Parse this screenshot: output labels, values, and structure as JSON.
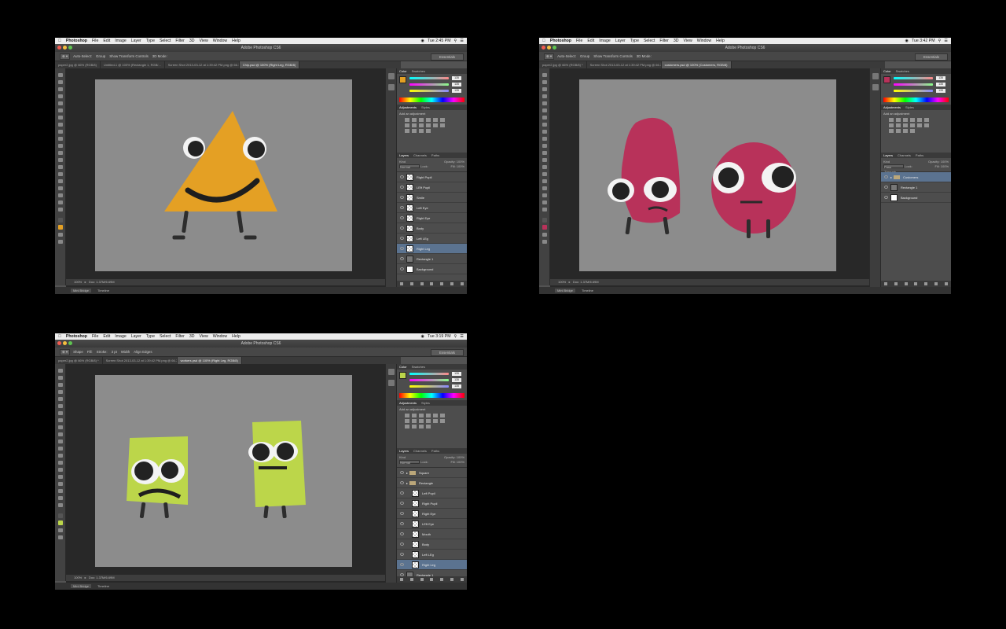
{
  "windows": [
    {
      "menubar": {
        "apple": "",
        "app": "Photoshop",
        "items": [
          "File",
          "Edit",
          "Image",
          "Layer",
          "Type",
          "Select",
          "Filter",
          "3D",
          "View",
          "Window",
          "Help"
        ],
        "clock": "Tue 2:45 PM"
      },
      "title": "Adobe Photoshop CS6",
      "options": [
        "Auto-Select:",
        "Group",
        "Show Transform Controls",
        "3D Mode:"
      ],
      "workspace": "Essentials",
      "tabs": [
        "paper2.jpg @ 66% (RGB/8)",
        "Untitled-1 @ 100% (Rectangle 1, RGB/...",
        "Screen Shot 2013-03-12 at 1:39:42 PM.png @ 66.7% (...",
        "Chip.psd @ 100% (Right Leg, RGB/8)"
      ],
      "status": {
        "zoom": "100%",
        "doc": "Doc: 1.37M/6.69M"
      },
      "bottom": [
        "Mini Bridge",
        "Timeline"
      ],
      "panel": {
        "color_tab": "Color",
        "swatches_tab": "Swatches",
        "rgb": [
          "135",
          "135",
          "135"
        ],
        "adjust_tab": "Adjustments",
        "styles_tab": "Styles",
        "adjust_label": "Add an adjustment",
        "layer_tabs": [
          "Layers",
          "Channels",
          "Paths"
        ],
        "kind": "Kind",
        "mode": "Normal",
        "opacity": "Opacity: 100%",
        "fill": "Fill: 100%",
        "lock": "Lock:"
      },
      "layers": [
        {
          "name": "Right Pupil",
          "type": "px"
        },
        {
          "name": "LEft Pupil",
          "type": "px"
        },
        {
          "name": "Smile",
          "type": "px"
        },
        {
          "name": "Left Eye",
          "type": "px"
        },
        {
          "name": "Right Eye",
          "type": "px"
        },
        {
          "name": "Body",
          "type": "px"
        },
        {
          "name": "Left LEg",
          "type": "px"
        },
        {
          "name": "Right Leg",
          "type": "px",
          "selected": true
        },
        {
          "name": "Rectangle 1",
          "type": "fill"
        },
        {
          "name": "Background",
          "type": "white"
        }
      ]
    },
    {
      "menubar": {
        "apple": "",
        "app": "Photoshop",
        "items": [
          "File",
          "Edit",
          "Image",
          "Layer",
          "Type",
          "Select",
          "Filter",
          "3D",
          "View",
          "Window",
          "Help"
        ],
        "clock": "Tue 3:42 PM"
      },
      "title": "Adobe Photoshop CS6",
      "options": [
        "Auto-Select:",
        "Group",
        "Show Transform Controls",
        "3D Mode:"
      ],
      "workspace": "Essentials",
      "tabs": [
        "paper2.jpg @ 66% (RGB/8) *",
        "Screen Shot 2013-03-12 at 1:39:42 PM.png @ 66.7% (RGB/8*) *",
        "customers.psd @ 100% (Customers, RGB/8)"
      ],
      "status": {
        "zoom": "100%",
        "doc": "Doc: 1.37M/6.69M"
      },
      "bottom": [
        "Mini Bridge",
        "Timeline"
      ],
      "panel": {
        "color_tab": "Color",
        "swatches_tab": "Swatches",
        "rgb": [
          "135",
          "135",
          "135"
        ],
        "adjust_tab": "Adjustments",
        "styles_tab": "Styles",
        "adjust_label": "Add an adjustment",
        "layer_tabs": [
          "Layers",
          "Channels",
          "Paths"
        ],
        "kind": "Kind",
        "mode": "Pass Through",
        "opacity": "Opacity: 100%",
        "fill": "Fill: 100%",
        "lock": "Lock:"
      },
      "layers": [
        {
          "name": "Customers",
          "type": "group",
          "selected": true
        },
        {
          "name": "Rectangle 1",
          "type": "fill"
        },
        {
          "name": "Background",
          "type": "white"
        }
      ]
    },
    {
      "menubar": {
        "apple": "",
        "app": "Photoshop",
        "items": [
          "File",
          "Edit",
          "Image",
          "Layer",
          "Type",
          "Select",
          "Filter",
          "3D",
          "View",
          "Window",
          "Help"
        ],
        "clock": "Tue 3:19 PM"
      },
      "title": "Adobe Photoshop CS6",
      "options": [
        "Shape",
        "Fill:",
        "Stroke:",
        "3 pt",
        "Width",
        "Align Edges"
      ],
      "workspace": "Essentials",
      "tabs": [
        "paper2.jpg @ 66% (RGB/8) *",
        "Screen Shot 2013-03-12 at 1:39:42 PM.png @ 66.7% (RGB/8*) *",
        "workers.psd @ 100% (Right Leg, RGB/8)"
      ],
      "status": {
        "zoom": "100%",
        "doc": "Doc: 1.37M/6.69M"
      },
      "bottom": [
        "Mini Bridge",
        "Timeline"
      ],
      "panel": {
        "color_tab": "Color",
        "swatches_tab": "Swatches",
        "rgb": [
          "135",
          "135",
          "135"
        ],
        "adjust_tab": "Adjustments",
        "styles_tab": "Styles",
        "adjust_label": "Add an adjustment",
        "layer_tabs": [
          "Layers",
          "Channels",
          "Paths"
        ],
        "kind": "Kind",
        "mode": "Normal",
        "opacity": "Opacity: 100%",
        "fill": "Fill: 100%",
        "lock": "Lock:"
      },
      "layers": [
        {
          "name": "Square",
          "type": "group"
        },
        {
          "name": "Rectangle",
          "type": "group",
          "indent": true
        },
        {
          "name": "Left Pupil",
          "type": "px",
          "indent": true
        },
        {
          "name": "Right Pupil",
          "type": "px",
          "indent": true
        },
        {
          "name": "Right Eye",
          "type": "px",
          "indent": true
        },
        {
          "name": "LEft Eye",
          "type": "px",
          "indent": true
        },
        {
          "name": "Mouth",
          "type": "px",
          "indent": true
        },
        {
          "name": "Body",
          "type": "px",
          "indent": true
        },
        {
          "name": "Left LEg",
          "type": "px",
          "indent": true
        },
        {
          "name": "Right Leg",
          "type": "px",
          "indent": true,
          "selected": true
        },
        {
          "name": "Rectangle 1",
          "type": "fill"
        }
      ]
    }
  ],
  "colors": {
    "chip": "#e4a024",
    "customer": "#b8325a",
    "worker": "#bcd64a",
    "canvas": "#8c8c8c",
    "selected_layer": "#5b7390"
  }
}
